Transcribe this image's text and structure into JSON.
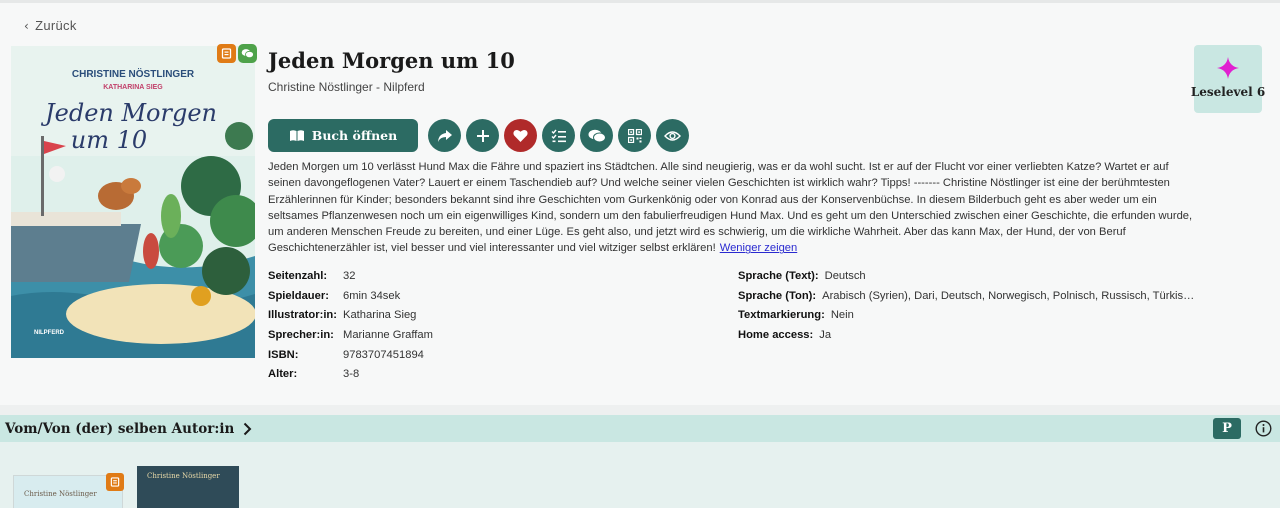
{
  "nav": {
    "back_label": "Zurück"
  },
  "book": {
    "title": "Jeden Morgen um 10",
    "author_line": "Christine Nöstlinger - Nilpferd",
    "cover": {
      "author_top": "CHRISTINE NÖSTLINGER",
      "illustrator_top": "KATHARINA SIEG",
      "title_line1": "Jeden Morgen",
      "title_line2": "um 10",
      "publisher": "NILPFERD"
    },
    "description": "Jeden Morgen um 10 verlässt Hund Max die Fähre und spaziert ins Städtchen. Alle sind neugierig, was er da wohl sucht. Ist er auf der Flucht vor einer verliebten Katze? Wartet er auf seinen davongeflogenen Vater? Lauert er einem Taschendieb auf? Und welche seiner vielen Geschichten ist wirklich wahr? Tipps! ------- Christine Nöstlinger ist eine der berühmtesten Erzählerinnen für Kinder; besonders bekannt sind ihre Geschichten vom Gurkenkönig oder von Konrad aus der Konservenbüchse. In diesem Bilderbuch geht es aber weder um ein seltsames Pflanzenwesen noch um ein eigenwilliges Kind, sondern um den fabulierfreudigen Hund Max. Und es geht um den Unterschied zwischen einer Geschichte, die erfunden wurde, um anderen Menschen Freude zu bereiten, und einer Lüge. Es geht also, und jetzt wird es schwierig, um die wirkliche Wahrheit. Aber das kann Max, der Hund, der von Beruf Geschichtenerzähler ist, viel besser und viel interessanter und viel witziger selbst erklären!",
    "show_less_label": "Weniger zeigen",
    "open_button_label": "Buch öffnen",
    "meta_left": [
      {
        "key": "Seitenzahl:",
        "value": "32"
      },
      {
        "key": "Spieldauer:",
        "value": "6min 34sek"
      },
      {
        "key": "Illustrator:in:",
        "value": "Katharina Sieg"
      },
      {
        "key": "Sprecher:in:",
        "value": "Marianne Graffam"
      },
      {
        "key": "ISBN:",
        "value": "9783707451894"
      },
      {
        "key": "Alter:",
        "value": "3-8"
      }
    ],
    "meta_right": [
      {
        "key": "Sprache (Text):",
        "value": "Deutsch"
      },
      {
        "key": "Sprache (Ton):",
        "value": "Arabisch (Syrien), Dari, Deutsch, Norwegisch, Polnisch, Russisch, Türkis…"
      },
      {
        "key": "Textmarkierung:",
        "value": "Nein"
      },
      {
        "key": "Home access:",
        "value": "Ja"
      }
    ],
    "level_label": "Leselevel 6"
  },
  "section": {
    "title": "Vom/Von (der) selben Autor:in",
    "p_label": "P"
  },
  "related": {
    "thumb1_text": "Christine Nöstlinger",
    "thumb2_text": "Christine Nöstlinger"
  },
  "colors": {
    "primary": "#2c6b63",
    "favorite": "#b02a2a",
    "badge_orange": "#e07b16",
    "badge_green": "#4ea24a",
    "band": "#c9e7e2",
    "level_star": "#e020d0"
  },
  "icons": [
    "chevron-left-icon",
    "audio-book-icon",
    "chat-icon",
    "book-open-icon",
    "share-icon",
    "plus-icon",
    "heart-icon",
    "checklist-icon",
    "comments-icon",
    "qr-code-icon",
    "eye-icon",
    "star-icon",
    "chevron-right-icon",
    "info-icon"
  ]
}
